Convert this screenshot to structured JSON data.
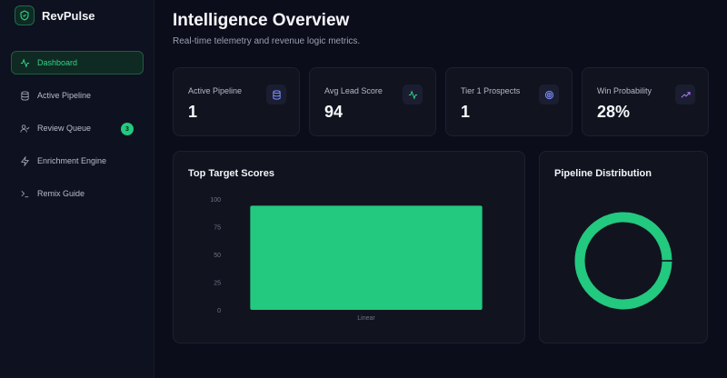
{
  "app": {
    "name": "RevPulse"
  },
  "sidebar": {
    "items": [
      {
        "label": "Dashboard",
        "icon": "activity-icon",
        "active": true
      },
      {
        "label": "Active Pipeline",
        "icon": "database-icon"
      },
      {
        "label": "Review Queue",
        "icon": "user-check-icon",
        "badge": "3"
      },
      {
        "label": "Enrichment Engine",
        "icon": "zap-icon"
      },
      {
        "label": "Remix Guide",
        "icon": "terminal-icon"
      }
    ]
  },
  "header": {
    "title": "Intelligence Overview",
    "subtitle": "Real-time telemetry and revenue logic metrics."
  },
  "stats": [
    {
      "label": "Active Pipeline",
      "value": "1",
      "icon": "database-icon",
      "color": "#7b8cff"
    },
    {
      "label": "Avg Lead Score",
      "value": "94",
      "icon": "activity-icon",
      "color": "#2fd48a"
    },
    {
      "label": "Tier 1 Prospects",
      "value": "1",
      "icon": "target-icon",
      "color": "#7b8cff"
    },
    {
      "label": "Win Probability",
      "value": "28%",
      "icon": "trending-up-icon",
      "color": "#b07cff"
    }
  ],
  "bar_card": {
    "title": "Top Target Scores"
  },
  "donut_card": {
    "title": "Pipeline Distribution"
  },
  "colors": {
    "accent": "#22c97f",
    "background": "#0b0d1a",
    "card": "#11141f"
  },
  "chart_data": [
    {
      "type": "bar",
      "title": "Top Target Scores",
      "categories": [
        "Linear"
      ],
      "values": [
        94
      ],
      "ylim": [
        0,
        100
      ],
      "yticks": [
        0,
        25,
        50,
        75,
        100
      ],
      "grid": false
    },
    {
      "type": "pie",
      "title": "Pipeline Distribution",
      "values": [
        1
      ],
      "donut": true
    }
  ]
}
